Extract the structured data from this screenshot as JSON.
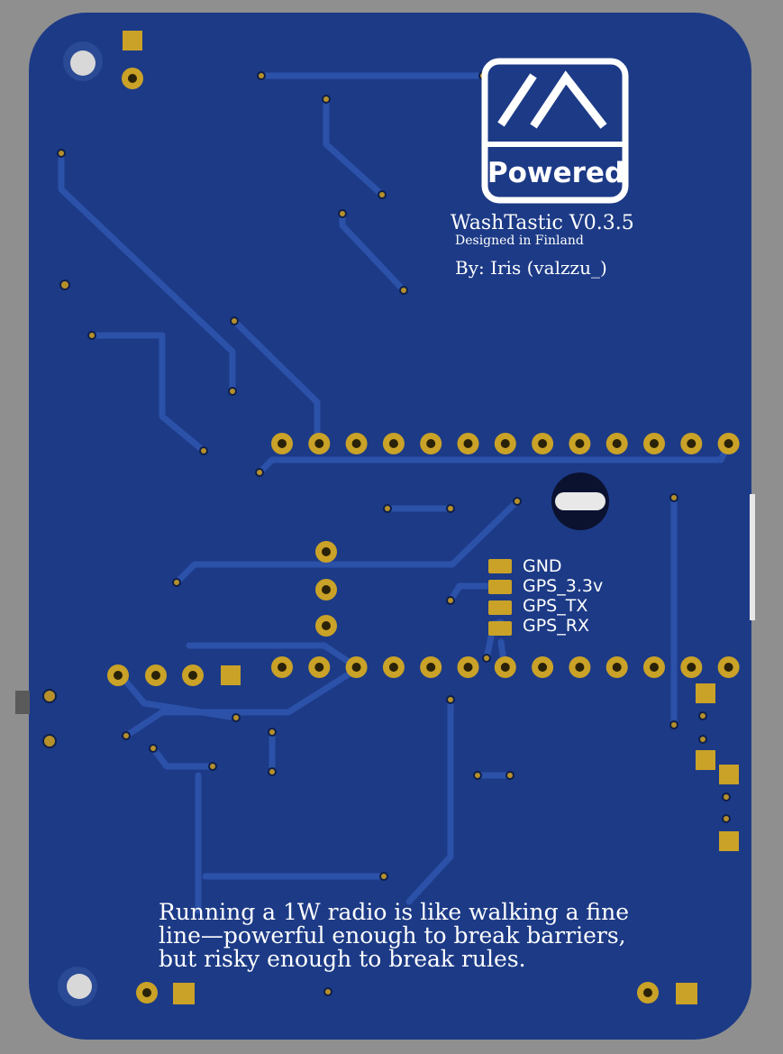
{
  "board": {
    "substrate_color": "#1c3a86",
    "copper_color": "#c9a227",
    "trace_color": "#274a9e",
    "silk_color": "#ffffff",
    "background_color": "#8f8f8f"
  },
  "logo": {
    "icon": "meshtastic-logo-icon",
    "label": "Powered"
  },
  "title": {
    "name": "WashTastic V0.3.5",
    "subtitle": "Designed in Finland",
    "author": "By: Iris (valzzu_)"
  },
  "pin_labels": [
    "GND",
    "GPS_3.3v",
    "GPS_TX",
    "GPS_RX"
  ],
  "quote": {
    "line1": "Running a 1W radio is like walking a fine",
    "line2": "line—powerful enough to break barriers,",
    "line3": "but risky enough to break rules."
  }
}
